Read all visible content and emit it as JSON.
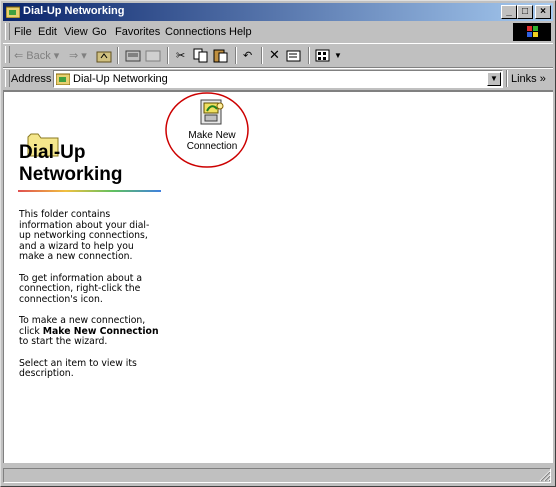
{
  "window": {
    "title": "Dial-Up Networking"
  },
  "menu": {
    "items": [
      "File",
      "Edit",
      "View",
      "Go",
      "Favorites",
      "Connections",
      "Help"
    ]
  },
  "toolbar": {
    "back_label": "Back"
  },
  "address": {
    "label": "Address",
    "value": "Dial-Up Networking",
    "links_label": "Links »"
  },
  "sidebar": {
    "heading_line1": "Dial-Up",
    "heading_line2": "Networking",
    "para1": "This folder contains information about your dial-up networking connections, and a wizard to help you make a new connection.",
    "para2": "To get information about a connection, right-click the connection's icon.",
    "para3_prefix": "To make a new connection, click",
    "para3_bold": "Make New Connection",
    "para3_suffix": "to start the wizard.",
    "para4": "Select an item to view its description."
  },
  "items": [
    {
      "label_line1": "Make New",
      "label_line2": "Connection"
    }
  ],
  "colors": {
    "titlebar_start": "#0a246a",
    "titlebar_end": "#a6caf0",
    "annotation": "#cc0000"
  }
}
